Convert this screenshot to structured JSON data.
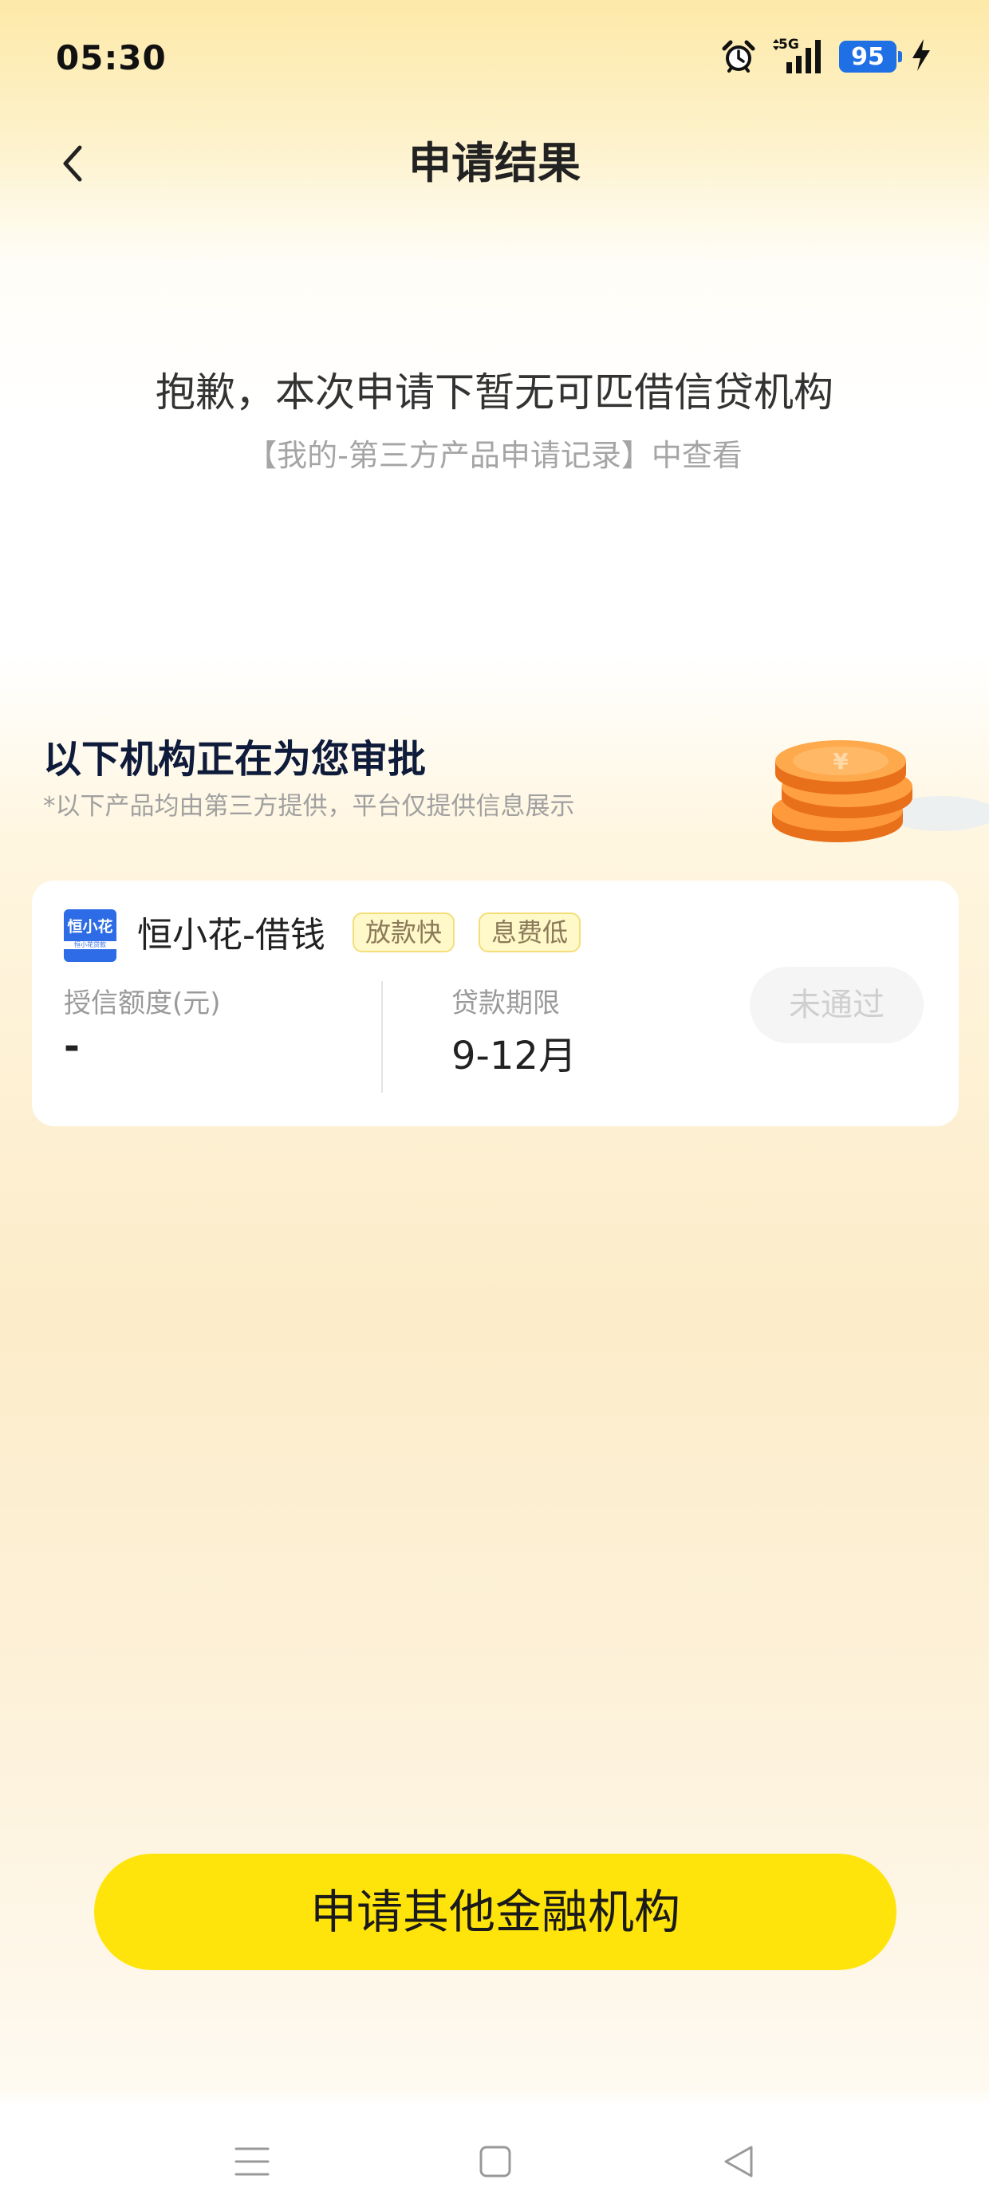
{
  "status_bar": {
    "time": "05:30",
    "network": "5G",
    "battery": "95",
    "icons": [
      "alarm-icon",
      "signal-icon",
      "battery-icon",
      "charging-icon"
    ]
  },
  "header": {
    "title": "申请结果",
    "back_icon": "chevron-left-icon"
  },
  "result": {
    "message": "抱歉，本次申请下暂无可匹借信贷机构",
    "sub_message": "【我的-第三方产品申请记录】中查看"
  },
  "section": {
    "title": "以下机构正在为您审批",
    "note": "*以下产品均由第三方提供，平台仅提供信息展示",
    "decoration": "coins-stack"
  },
  "product": {
    "logo_text": "恒小花",
    "logo_subtext": "恒小花贷款",
    "name": "恒小花-借钱",
    "tags": [
      "放款快",
      "息费低"
    ],
    "credit_limit_label": "授信额度(元)",
    "credit_limit_value": "-",
    "term_label": "贷款期限",
    "term_value": "9-12月",
    "status": "未通过"
  },
  "cta": {
    "label": "申请其他金融机构"
  },
  "colors": {
    "accent_yellow": "#ffe40c",
    "tag_border": "#f3de7a",
    "tag_bg": "#fff8c8",
    "logo_blue": "#2e6be6",
    "battery_blue": "#1f6fe5"
  },
  "system_nav": [
    "menu-icon",
    "home-icon",
    "back-icon"
  ]
}
